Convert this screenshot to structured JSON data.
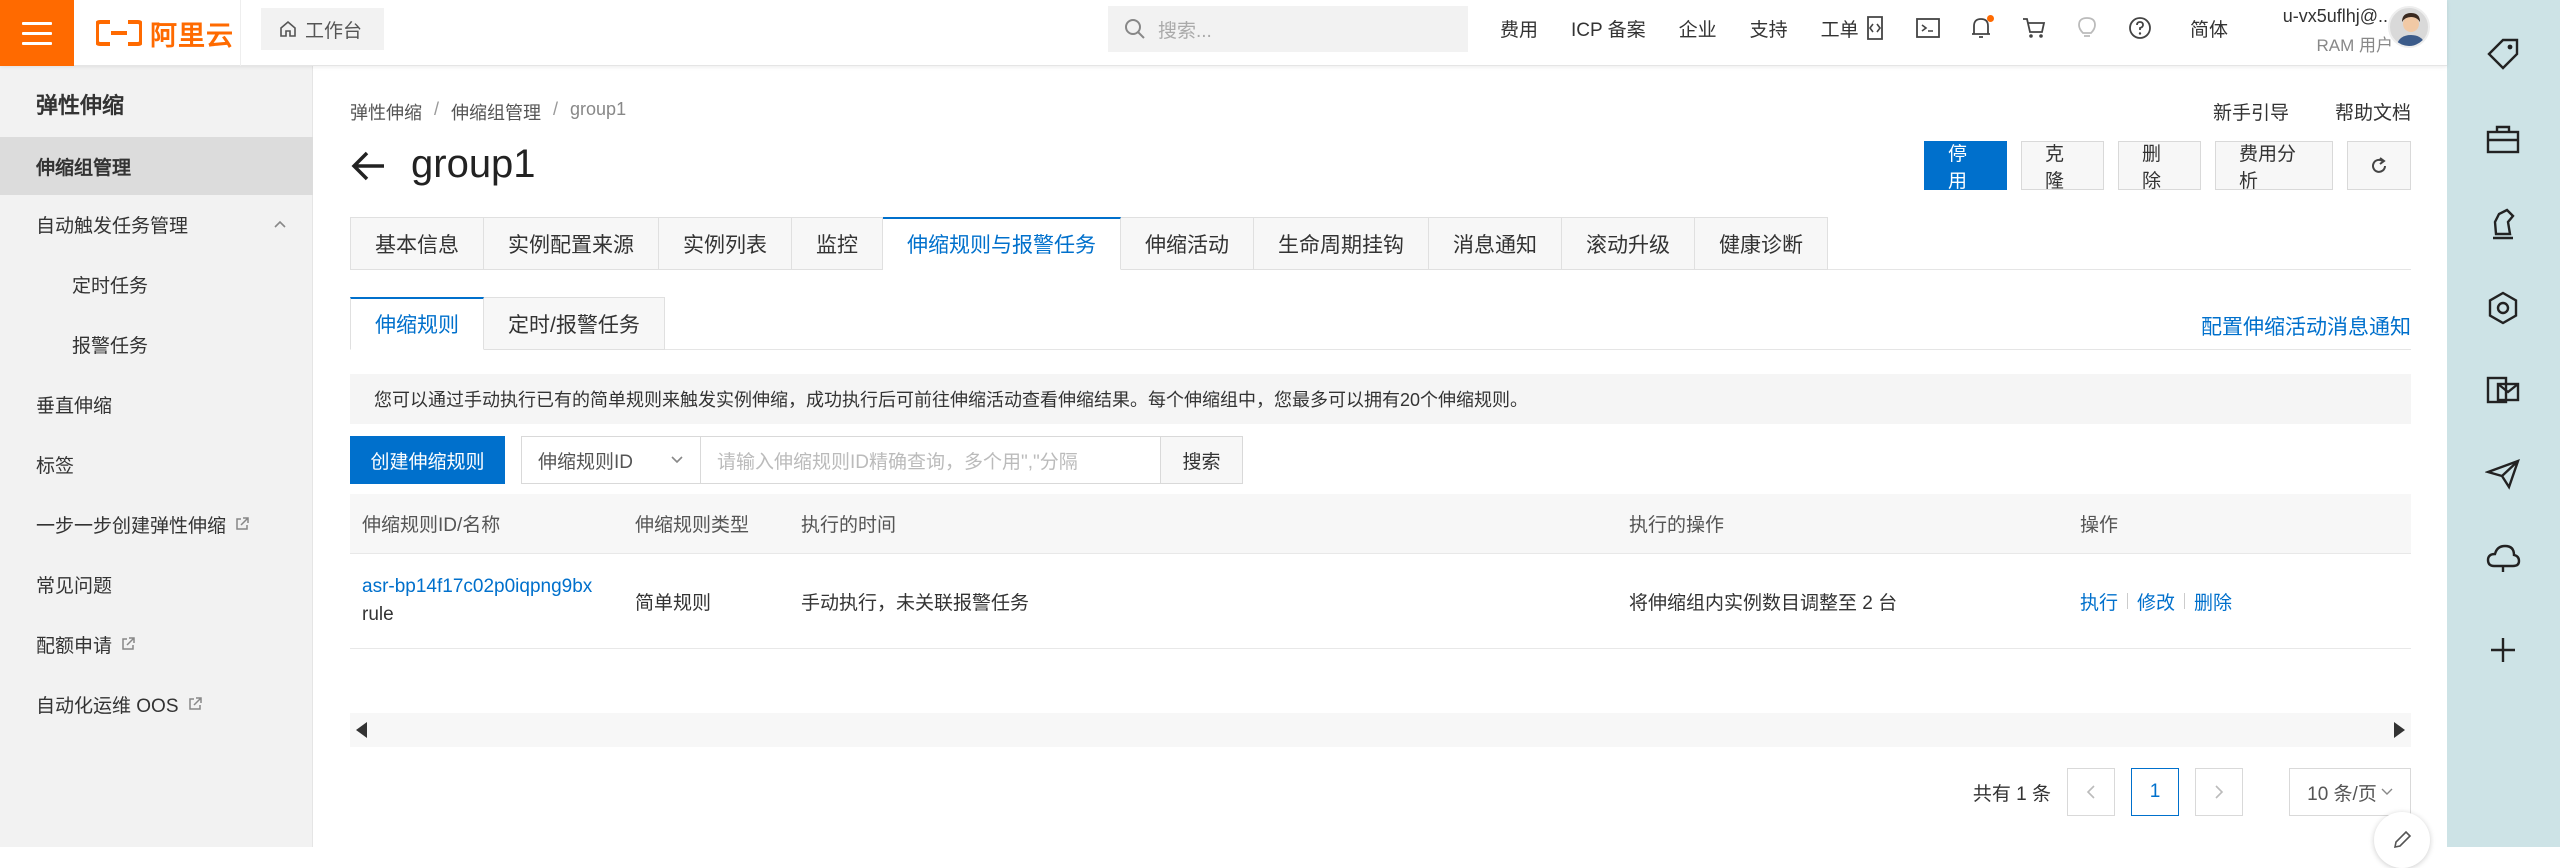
{
  "topbar": {
    "logo_text": "阿里云",
    "workbench_label": "工作台",
    "search_placeholder": "搜索...",
    "nav": [
      "费用",
      "ICP 备案",
      "企业",
      "支持",
      "工单"
    ],
    "icons": [
      "code-icon",
      "terminal-icon",
      "bell-icon",
      "cart-icon",
      "lightbulb-icon",
      "help-icon"
    ],
    "language": "简体",
    "user_name": "u-vx5uflhj@...",
    "user_role": "RAM 用户",
    "accent_color": "#ff6a00"
  },
  "sidebar": {
    "title": "弹性伸缩",
    "items": [
      {
        "label": "伸缩组管理",
        "active": true
      },
      {
        "label": "自动触发任务管理",
        "expandable": true
      },
      {
        "label": "定时任务",
        "sub": true
      },
      {
        "label": "报警任务",
        "sub": true
      },
      {
        "label": "垂直伸缩"
      },
      {
        "label": "标签"
      },
      {
        "label": "一步一步创建弹性伸缩",
        "external": true
      },
      {
        "label": "常见问题"
      },
      {
        "label": "配额申请",
        "external": true
      },
      {
        "label": "自动化运维 OOS",
        "external": true
      }
    ]
  },
  "main": {
    "breadcrumb": [
      "弹性伸缩",
      "伸缩组管理",
      "group1"
    ],
    "help_links": [
      "新手引导",
      "帮助文档"
    ],
    "title": "group1",
    "actions": {
      "disable": "停用",
      "clone": "克隆",
      "delete": "删除",
      "cost": "费用分析"
    },
    "tabs": [
      "基本信息",
      "实例配置来源",
      "实例列表",
      "监控",
      "伸缩规则与报警任务",
      "伸缩活动",
      "生命周期挂钩",
      "消息通知",
      "滚动升级",
      "健康诊断"
    ],
    "active_tab": 4,
    "subtabs": [
      "伸缩规则",
      "定时/报警任务"
    ],
    "config_link": "配置伸缩活动消息通知",
    "notice": "您可以通过手动执行已有的简单规则来触发实例伸缩，成功执行后可前往伸缩活动查看伸缩结果。每个伸缩组中，您最多可以拥有20个伸缩规则。",
    "create_button": "创建伸缩规则",
    "filter_select": "伸缩规则ID",
    "filter_placeholder": "请输入伸缩规则ID精确查询，多个用\",\"分隔",
    "search_button": "搜索",
    "table": {
      "headers": [
        "伸缩规则ID/名称",
        "伸缩规则类型",
        "执行的时间",
        "执行的操作",
        "操作"
      ],
      "rows": [
        {
          "id": "asr-bp14f17c02p0iqpng9bx",
          "name": "rule",
          "type": "简单规则",
          "time": "手动执行，未关联报警任务",
          "action": "将伸缩组内实例数目调整至 2 台",
          "ops": [
            "执行",
            "修改",
            "删除"
          ]
        }
      ]
    },
    "pager": {
      "total": "共有 1 条",
      "current": "1",
      "page_size": "10 条/页"
    },
    "primary_color": "#0070cc"
  },
  "rail": {
    "icons": [
      "tag-icon",
      "toolbox-icon",
      "chess-icon",
      "hexagon-icon",
      "mail-sync-icon",
      "send-icon",
      "cloud-icon",
      "plus-icon"
    ],
    "background": "#cde3e6"
  }
}
